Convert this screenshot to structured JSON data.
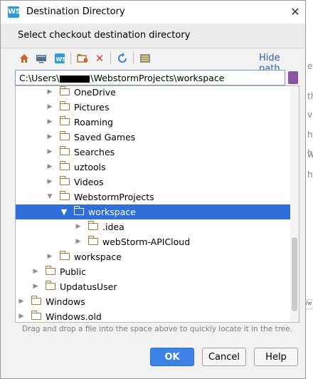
{
  "window": {
    "title": "Destination Directory",
    "app_icon": "webstorm-icon",
    "header": "Select checkout destination directory"
  },
  "toolbar": {
    "icons": [
      "home-icon",
      "desktop-icon",
      "project-icon",
      "new-folder-icon",
      "delete-icon",
      "refresh-icon",
      "show-hidden-icon"
    ],
    "hide_path_label": "Hide path"
  },
  "path": {
    "prefix": "C:\\Users\\",
    "suffix": "\\WebstormProjects\\workspace"
  },
  "tree": {
    "items": [
      {
        "label": "OneDrive",
        "depth": 3,
        "expanded": false,
        "selected": false
      },
      {
        "label": "Pictures",
        "depth": 3,
        "expanded": false,
        "selected": false
      },
      {
        "label": "Roaming",
        "depth": 3,
        "expanded": false,
        "selected": false
      },
      {
        "label": "Saved Games",
        "depth": 3,
        "expanded": false,
        "selected": false
      },
      {
        "label": "Searches",
        "depth": 3,
        "expanded": false,
        "selected": false
      },
      {
        "label": "uztools",
        "depth": 3,
        "expanded": false,
        "selected": false
      },
      {
        "label": "Videos",
        "depth": 3,
        "expanded": false,
        "selected": false
      },
      {
        "label": "WebstormProjects",
        "depth": 3,
        "expanded": true,
        "selected": false
      },
      {
        "label": "workspace",
        "depth": 4,
        "expanded": true,
        "selected": true
      },
      {
        "label": ".idea",
        "depth": 5,
        "expanded": false,
        "selected": false
      },
      {
        "label": "webStorm-APICloud",
        "depth": 5,
        "expanded": false,
        "selected": false
      },
      {
        "label": "workspace",
        "depth": 3,
        "expanded": false,
        "selected": false
      },
      {
        "label": "Public",
        "depth": 2,
        "expanded": false,
        "selected": false
      },
      {
        "label": "UpdatusUser",
        "depth": 2,
        "expanded": false,
        "selected": false
      },
      {
        "label": "Windows",
        "depth": 1,
        "expanded": false,
        "selected": false
      },
      {
        "label": "Windows.old",
        "depth": 1,
        "expanded": false,
        "selected": false
      }
    ]
  },
  "hint": "Drag and drop a file into the space above to quickly locate it in the tree.",
  "buttons": {
    "ok": "OK",
    "cancel": "Cancel",
    "help": "Help"
  },
  "background": {
    "chars": [
      "e",
      "th",
      "vi",
      "h",
      "h",
      "w",
      "h"
    ],
    "ruler_left": "ox",
    "ruler_right": "/w"
  },
  "colors": {
    "selection": "#2f6fdb",
    "link": "#2a62b8",
    "folder": "#a47a3c",
    "primary_button": "#3d82e6"
  }
}
